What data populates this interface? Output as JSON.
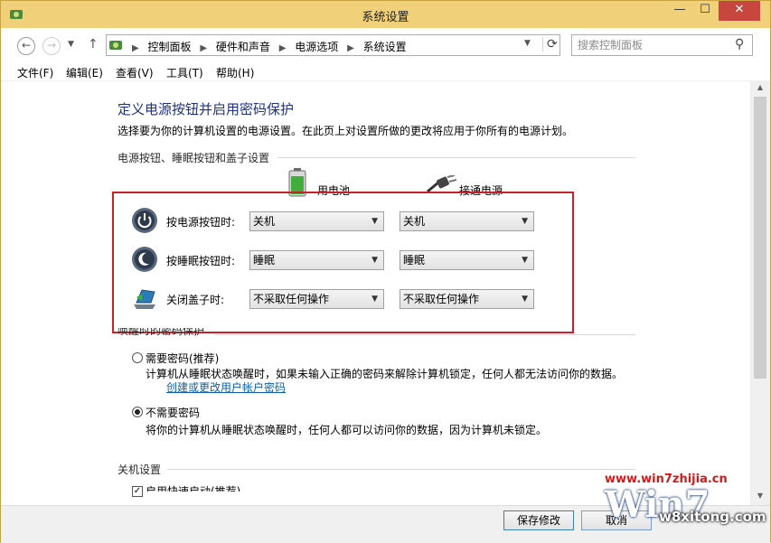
{
  "window": {
    "title": "系统设置",
    "close_label": "✕"
  },
  "nav": {
    "breadcrumbs": [
      "控制面板",
      "硬件和声音",
      "电源选项",
      "系统设置"
    ]
  },
  "search": {
    "placeholder": "搜索控制面板"
  },
  "menu": [
    "文件(F)",
    "编辑(E)",
    "查看(V)",
    "工具(T)",
    "帮助(H)"
  ],
  "page": {
    "heading": "定义电源按钮并启用密码保护",
    "description": "选择要为你的计算机设置的电源设置。在此页上对设置所做的更改将应用于你所有的电源计划。",
    "section_buttons": "电源按钮、睡眠按钮和盖子设置",
    "col_battery": "用电池",
    "col_plugged": "接通电源",
    "rows": [
      {
        "label": "按电源按钮时:",
        "battery": "关机",
        "plugged": "关机",
        "icon": "power-icon"
      },
      {
        "label": "按睡眠按钮时:",
        "battery": "睡眠",
        "plugged": "睡眠",
        "icon": "sleep-icon"
      },
      {
        "label": "关闭盖子时:",
        "battery": "不采取任何操作",
        "plugged": "不采取任何操作",
        "icon": "laptop-lid-icon"
      }
    ],
    "section_wake": "唤醒时的密码保护",
    "opt_require": "需要密码(推荐)",
    "opt_require_desc": "计算机从睡眠状态唤醒时，如果未输入正确的密码来解除计算机锁定，任何人都无法访问你的数据。",
    "opt_require_link": "创建或更改用户帐户密码",
    "opt_norequire": "不需要密码",
    "opt_norequire_desc": "将你的计算机从睡眠状态唤醒时，任何人都可以访问你的数据，因为计算机未锁定。",
    "section_shutdown": "关机设置",
    "fast_startup": "启用快速启动(推荐)"
  },
  "footer": {
    "save": "保存修改",
    "cancel": "取消"
  },
  "watermark": {
    "url": "www.win7zhijia.cn",
    "logo": "Win7",
    "url2": "w8xitong.com"
  },
  "colors": {
    "heading": "#1e3287",
    "highlight": "#c6222b",
    "link": "#0b62a8",
    "titlebar": "#f1d07a"
  }
}
